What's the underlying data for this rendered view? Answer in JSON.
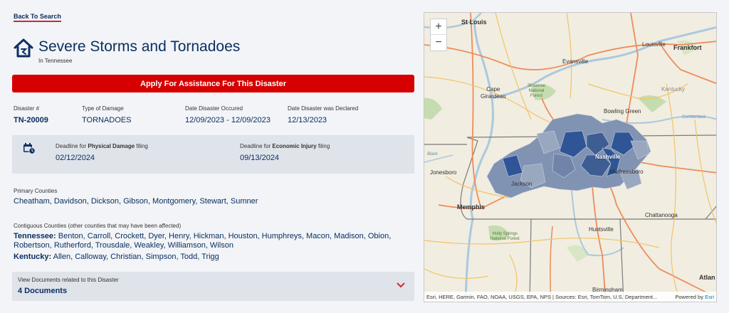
{
  "nav": {
    "back_label": "Back To Search"
  },
  "disaster": {
    "title": "Severe Storms and Tornadoes",
    "subtitle": "In Tennessee",
    "apply_label": "Apply For Assistance For This Disaster",
    "number_label": "Disaster #",
    "number": "TN-20009",
    "damage_label": "Type of Damage",
    "damage": "TORNADOES",
    "occurred_label": "Date Disaster Occured",
    "occurred": "12/09/2023 - 12/09/2023",
    "declared_label": "Date Disaster was Declared",
    "declared": "12/13/2023"
  },
  "deadlines": {
    "physical_prefix": "Deadline for ",
    "physical_bold": "Physical Damage",
    "physical_suffix": " filing",
    "physical_date": "02/12/2024",
    "economic_prefix": "Deadline for ",
    "economic_bold": "Economic Injury",
    "economic_suffix": " filing",
    "economic_date": "09/13/2024"
  },
  "counties": {
    "primary_label": "Primary Counties",
    "primary": "Cheatham, Davidson, Dickson, Gibson, Montgomery, Stewart, Sumner",
    "contiguous_label": "Contiguous Counties (other counties that may have been affected)",
    "tn_label": "Tennessee:",
    "tn_line1": " Benton, Carroll, Crockett, Dyer, Henry, Hickman, Houston, Humphreys, Macon, Madison, Obion,",
    "tn_line2": "Robertson, Rutherford, Trousdale, Weakley, Williamson, Wilson",
    "ky_label": "Kentucky:",
    "ky_list": " Allen, Calloway, Christian, Simpson, Todd, Trigg"
  },
  "documents": {
    "label": "View Documents related to this Disaster",
    "count": "4 Documents"
  },
  "map": {
    "zoom_in": "+",
    "zoom_out": "−",
    "attribution": "Esri, HERE, Garmin, FAO, NOAA, USGS, EPA, NPS | Sources: Esri, TomTom, U.S. Department...",
    "powered_prefix": "Powered by ",
    "powered_brand": "Esri",
    "labels": {
      "st_louis": "St Louis",
      "louisville": "Louisville",
      "frankfort": "Frankfort",
      "evansville": "Evansville",
      "kentucky": "Kentucky",
      "cape_girardeau": "Cape\nGirardeau",
      "bowling_green": "Bowling Green",
      "nashville": "Nashville",
      "murfreesboro": "Murfreesboro",
      "jonesboro": "Jonesboro",
      "jackson": "Jackson",
      "memphis": "Memphis",
      "chattanooga": "Chattanooga",
      "huntsville": "Huntsville",
      "birmingham": "Birmingham",
      "atlanta": "Atlan",
      "shawnee": "Shawnee\nNational\nForest",
      "holly_springs": "Holly Springs\nNational Forest",
      "black": "Black",
      "cumberland": "Cumberland"
    },
    "colors": {
      "primary_county": "#2f5597",
      "contiguous_county": "#8093b3",
      "water": "#aac9de",
      "forest": "#c5dcb0",
      "road": "#f2c366",
      "interstate": "#ef8b5a",
      "state_line": "#7a7a7a"
    }
  },
  "theme": {
    "navy": "#0b2f61",
    "red": "#d70000",
    "panel": "#dfe3ea"
  }
}
